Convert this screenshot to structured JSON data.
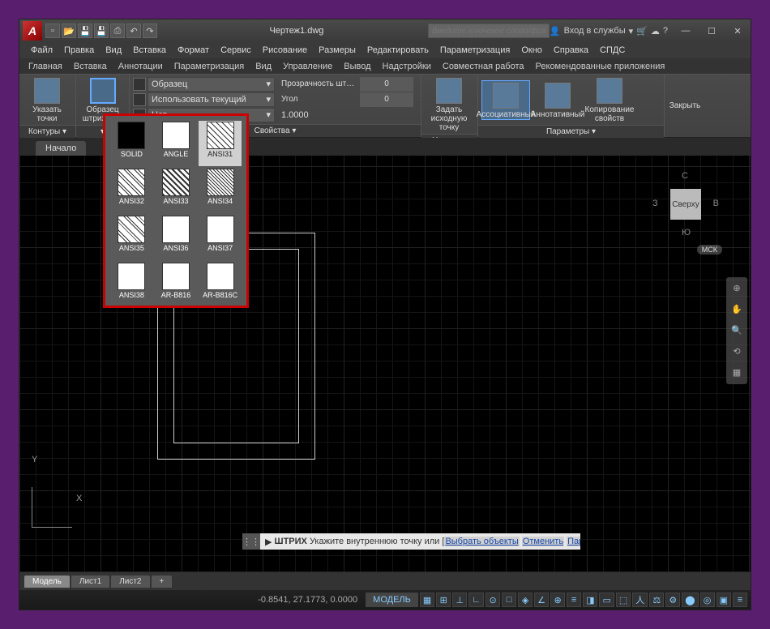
{
  "title": "Чертеж1.dwg",
  "search_placeholder": "Введите ключевое слово/фразу",
  "login": "Вход в службы",
  "menus": [
    "Файл",
    "Правка",
    "Вид",
    "Вставка",
    "Формат",
    "Сервис",
    "Рисование",
    "Размеры",
    "Редактировать",
    "Параметризация",
    "Окно",
    "Справка",
    "СПДС"
  ],
  "ribbon_tabs": [
    "Главная",
    "Вставка",
    "Аннотации",
    "Параметризация",
    "Вид",
    "Управление",
    "Вывод",
    "Надстройки",
    "Совместная работа",
    "Рекомендованные приложения"
  ],
  "panels": {
    "contours": {
      "title": "Контуры",
      "btn": "Указать точки"
    },
    "pattern_btn": "Образец штриховки",
    "props": {
      "title": "Свойства",
      "type": "Образец",
      "color": "Использовать текущий",
      "none": "Нет",
      "transparency": "Прозрачность шт…",
      "transp_val": "0",
      "angle": "Угол",
      "angle_val": "0",
      "scale": "1.0000"
    },
    "origin": {
      "title": "Начало",
      "btn": "Задать исходную точку"
    },
    "options": {
      "title": "Параметры",
      "assoc": "Ассоциативный",
      "annot": "Аннотативный",
      "copy": "Копирование свойств"
    },
    "close": "Закрыть"
  },
  "file_tab": "Начало",
  "viewcube": {
    "top": "Сверху",
    "n": "С",
    "s": "Ю",
    "e": "В",
    "w": "З",
    "mck": "МСК"
  },
  "patterns": [
    "SOLID",
    "ANGLE",
    "ANSI31",
    "ANSI32",
    "ANSI33",
    "ANSI34",
    "ANSI35",
    "ANSI36",
    "ANSI37",
    "ANSI38",
    "AR-B816",
    "AR-B816C"
  ],
  "pattern_classes": [
    "sw-solid",
    "sw-angle",
    "sw-ansi31",
    "sw-ansi32",
    "sw-ansi33",
    "sw-ansi34",
    "sw-ansi35",
    "sw-ansi36",
    "sw-ansi37",
    "sw-ansi38",
    "sw-brick",
    "sw-brick"
  ],
  "selected_pattern": 2,
  "cmd": {
    "name": "ШТРИХ",
    "prompt": "Укажите внутреннюю точку или [",
    "o1": "Выбрать объекты",
    "o2": "Отменить",
    "o3": "Параметры",
    "end": "]:"
  },
  "layouts": [
    "Модель",
    "Лист1",
    "Лист2"
  ],
  "coords": "-0.8541, 27.1773, 0.0000",
  "model": "МОДЕЛЬ"
}
